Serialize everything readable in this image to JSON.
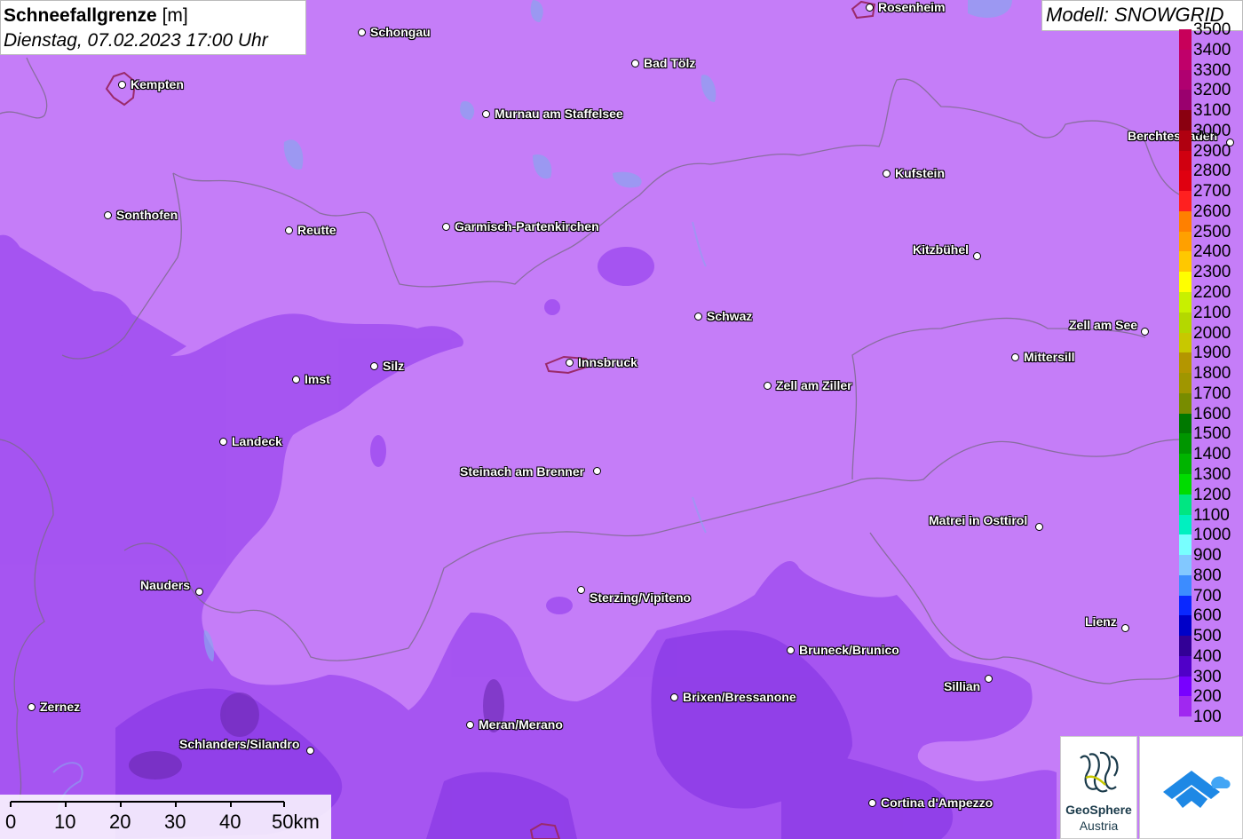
{
  "title": {
    "bold": "Schneefallgrenze",
    "unit": "[m]",
    "date": "Dienstag, 07.02.2023 17:00 Uhr"
  },
  "model": "Modell: SNOWGRID",
  "legend": [
    {
      "label": "3500",
      "color": "#c8005a"
    },
    {
      "label": "3400",
      "color": "#c0006a"
    },
    {
      "label": "3300",
      "color": "#b00070"
    },
    {
      "label": "3200",
      "color": "#9a006e"
    },
    {
      "label": "3100",
      "color": "#8a0010"
    },
    {
      "label": "3000",
      "color": "#b00010"
    },
    {
      "label": "2900",
      "color": "#d00010"
    },
    {
      "label": "2800",
      "color": "#e00010"
    },
    {
      "label": "2700",
      "color": "#ff2020"
    },
    {
      "label": "2600",
      "color": "#ff8000"
    },
    {
      "label": "2500",
      "color": "#ffa000"
    },
    {
      "label": "2400",
      "color": "#ffc800"
    },
    {
      "label": "2300",
      "color": "#ffff00"
    },
    {
      "label": "2200",
      "color": "#c8f000"
    },
    {
      "label": "2100",
      "color": "#b4d800"
    },
    {
      "label": "2000",
      "color": "#c8c800"
    },
    {
      "label": "1900",
      "color": "#b49600"
    },
    {
      "label": "1800",
      "color": "#a09600"
    },
    {
      "label": "1700",
      "color": "#788c00"
    },
    {
      "label": "1600",
      "color": "#007800"
    },
    {
      "label": "1500",
      "color": "#009600"
    },
    {
      "label": "1400",
      "color": "#00b400"
    },
    {
      "label": "1300",
      "color": "#00dc00"
    },
    {
      "label": "1200",
      "color": "#00e682"
    },
    {
      "label": "1100",
      "color": "#00f0c0"
    },
    {
      "label": "1000",
      "color": "#78ffff"
    },
    {
      "label": "900",
      "color": "#82c8ff"
    },
    {
      "label": "800",
      "color": "#3c8cff"
    },
    {
      "label": "700",
      "color": "#0a28ff"
    },
    {
      "label": "600",
      "color": "#0000c8"
    },
    {
      "label": "500",
      "color": "#320096"
    },
    {
      "label": "400",
      "color": "#5000c8"
    },
    {
      "label": "300",
      "color": "#7800ff"
    },
    {
      "label": "200",
      "color": "#a028f0"
    },
    {
      "label": "100",
      "color": "#c57df8"
    }
  ],
  "cities": [
    {
      "name": "Rosenheim",
      "label_side": "right"
    },
    {
      "name": "Schongau",
      "label_side": "right"
    },
    {
      "name": "Kempten",
      "label_side": "right"
    },
    {
      "name": "Bad Tölz",
      "label_side": "right"
    },
    {
      "name": "Murnau am Staffelsee",
      "label_side": "right"
    },
    {
      "name": "Berchtesgaden",
      "label_side": "left"
    },
    {
      "name": "Kufstein",
      "label_side": "right"
    },
    {
      "name": "Sonthofen",
      "label_side": "right"
    },
    {
      "name": "Reutte",
      "label_side": "right"
    },
    {
      "name": "Garmisch-Partenkirchen",
      "label_side": "right"
    },
    {
      "name": "Kitzbühel",
      "label_side": "left"
    },
    {
      "name": "Schwaz",
      "label_side": "right"
    },
    {
      "name": "Zell am See",
      "label_side": "left"
    },
    {
      "name": "Silz",
      "label_side": "right"
    },
    {
      "name": "Innsbruck",
      "label_side": "right"
    },
    {
      "name": "Mittersill",
      "label_side": "right"
    },
    {
      "name": "Imst",
      "label_side": "right"
    },
    {
      "name": "Zell am Ziller",
      "label_side": "right"
    },
    {
      "name": "Landeck",
      "label_side": "right"
    },
    {
      "name": "Steinach am Brenner",
      "label_side": "left"
    },
    {
      "name": "Matrei in Osttirol",
      "label_side": "left"
    },
    {
      "name": "Nauders",
      "label_side": "left"
    },
    {
      "name": "Sterzing/Vipiteno",
      "label_side": "right"
    },
    {
      "name": "Lienz",
      "label_side": "left"
    },
    {
      "name": "Bruneck/Brunico",
      "label_side": "right"
    },
    {
      "name": "Sillian",
      "label_side": "left"
    },
    {
      "name": "Brixen/Bressanone",
      "label_side": "right"
    },
    {
      "name": "Zernez",
      "label_side": "right"
    },
    {
      "name": "Meran/Merano",
      "label_side": "right"
    },
    {
      "name": "Schlanders/Silandro",
      "label_side": "left"
    },
    {
      "name": "Cortina d'Ampezzo",
      "label_side": "right"
    }
  ],
  "scale": {
    "ticks": [
      "0",
      "10",
      "20",
      "30",
      "40",
      "50km"
    ]
  },
  "logo": {
    "name": "GeoSphere",
    "sub": "Austria"
  }
}
